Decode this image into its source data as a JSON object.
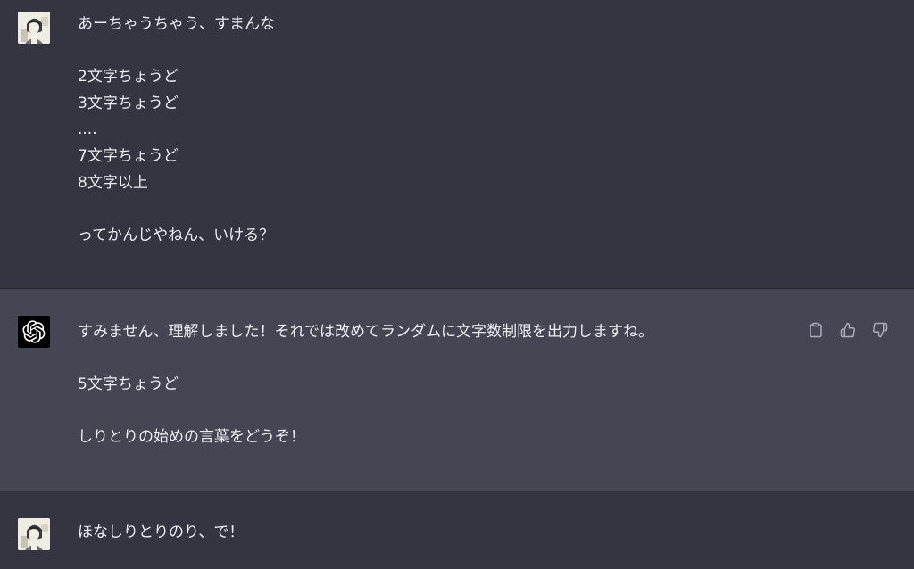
{
  "messages": [
    {
      "role": "user",
      "lines": [
        "あーちゃうちゃう、すまんな",
        "",
        "2文字ちょうど",
        "3文字ちょうど",
        "....",
        "7文字ちょうど",
        "8文字以上",
        "",
        "ってかんじやねん、いける？"
      ]
    },
    {
      "role": "assistant",
      "lines": [
        "すみません、理解しました！それでは改めてランダムに文字数制限を出力しますね。",
        "",
        "5文字ちょうど",
        "",
        "しりとりの始めの言葉をどうぞ！"
      ],
      "actions": [
        "clipboard-icon",
        "thumbs-up-icon",
        "thumbs-down-icon"
      ]
    },
    {
      "role": "user",
      "lines": [
        "ほなしりとりのり、で！"
      ]
    }
  ],
  "colors": {
    "user_bg": "#343541",
    "assistant_bg": "#444654",
    "text": "#ececf1",
    "icon": "#acacbe"
  }
}
